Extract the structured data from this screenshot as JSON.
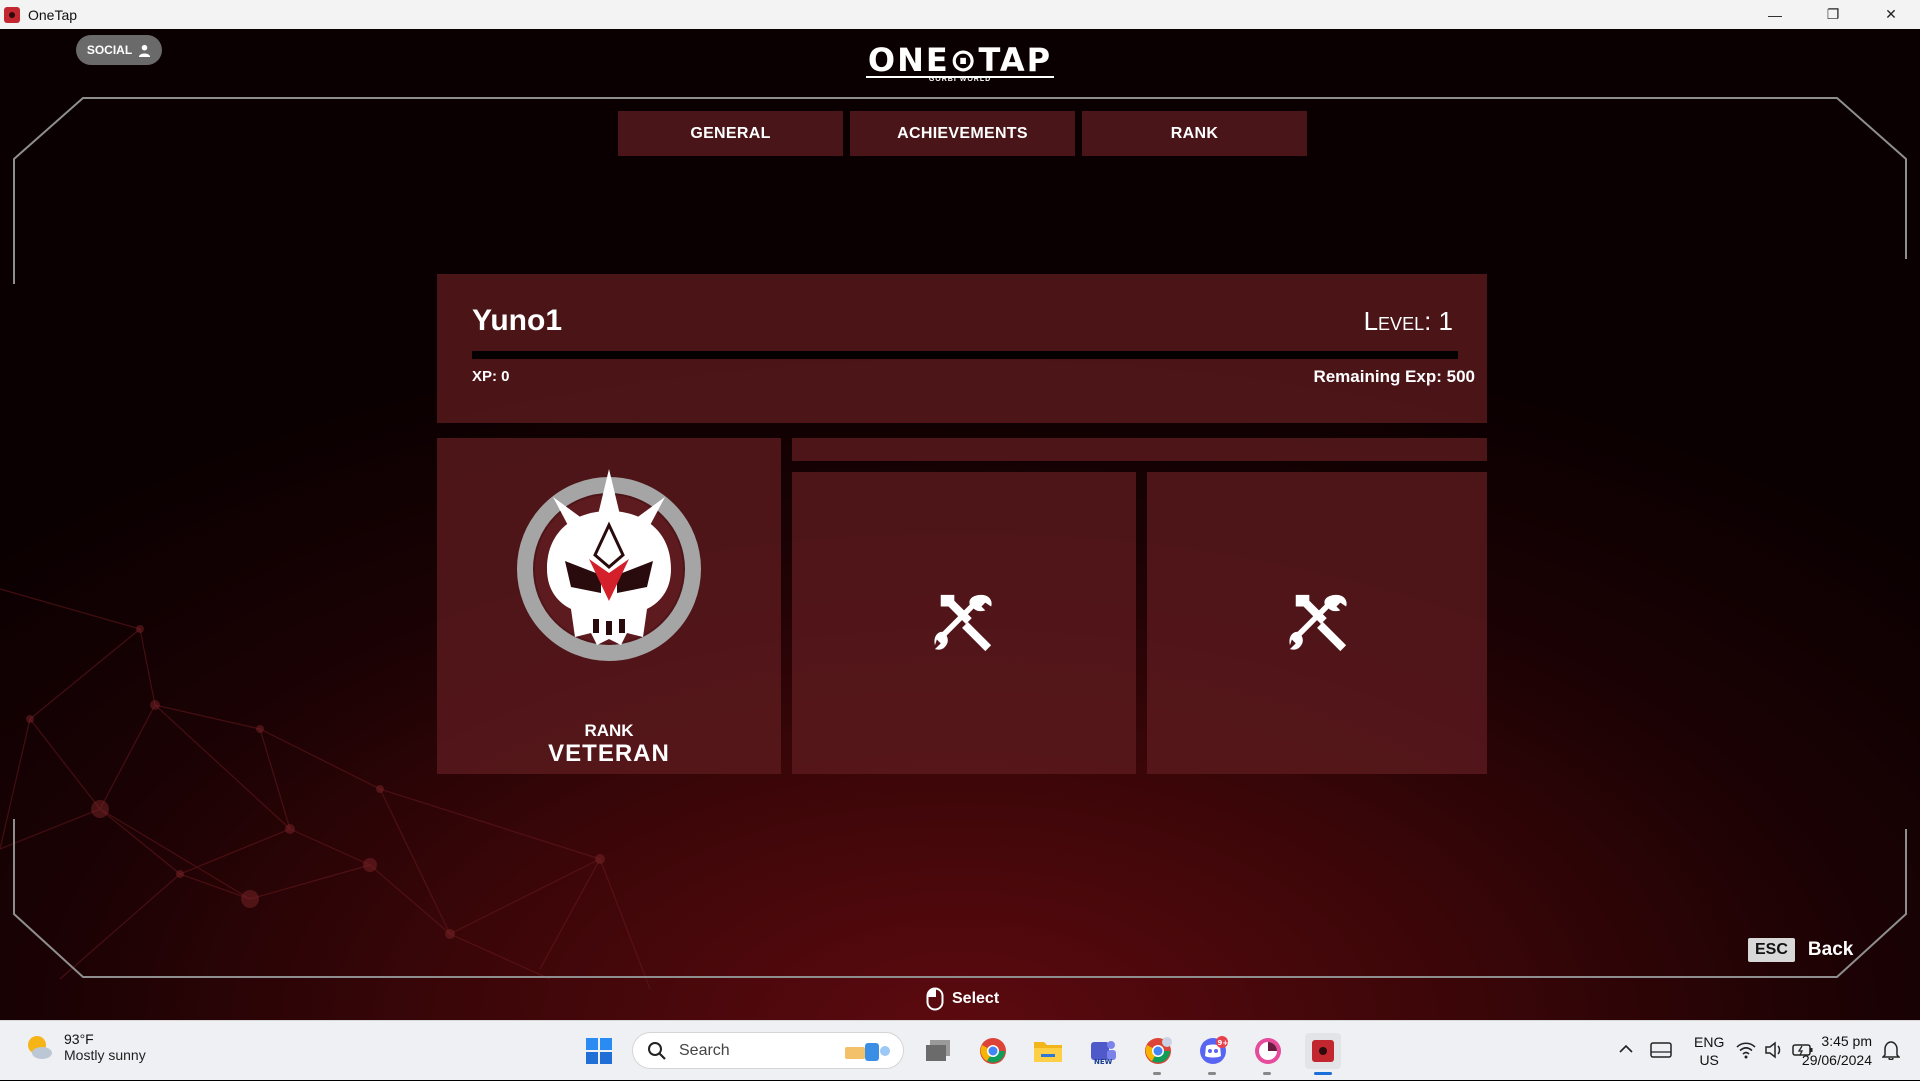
{
  "window": {
    "title": "OneTap",
    "minimize": "—",
    "restore": "❐",
    "close": "✕"
  },
  "header": {
    "social_label": "SOCIAL",
    "logo_text": "ONE⊙TAP",
    "logo_sub": "GORBI WORLD"
  },
  "tabs": [
    {
      "label": "GENERAL"
    },
    {
      "label": "ACHIEVEMENTS"
    },
    {
      "label": "RANK"
    }
  ],
  "profile": {
    "username": "Yuno1",
    "level_label": "Level: 1",
    "level": 1,
    "xp_label": "XP: 0",
    "xp": 0,
    "xp_progress": 0,
    "remaining_label": "Remaining Exp: 500",
    "remaining": 500
  },
  "rank": {
    "label": "RANK",
    "name": "VETERAN",
    "emblem_icon": "skull-crown-emblem",
    "accent_color": "#d4202a"
  },
  "tool_cards": [
    {
      "icon": "hammer-wrench-icon"
    },
    {
      "icon": "hammer-wrench-icon"
    }
  ],
  "hints": {
    "esc_key": "ESC",
    "esc_label": "Back",
    "select_label": "Select",
    "select_icon": "mouse-icon"
  },
  "taskbar": {
    "weather_temp": "93°F",
    "weather_desc": "Mostly sunny",
    "search_placeholder": "Search",
    "lang_1": "ENG",
    "lang_2": "US",
    "time": "3:45 pm",
    "date": "29/06/2024",
    "discord_badge": "9+"
  },
  "colors": {
    "panel": "#5e1b1f",
    "tab": "#4a1519",
    "background": "#3a0608"
  }
}
